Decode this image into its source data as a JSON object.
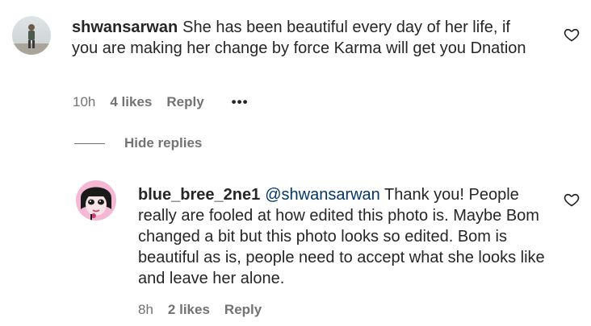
{
  "comments": [
    {
      "username": "shwansarwan",
      "mention": "",
      "text": "She has been beautiful every day of her life, if you are making her change by force Karma will get you Dnation",
      "time": "10h",
      "likes": "4 likes",
      "reply": "Reply",
      "more": "•••"
    }
  ],
  "hide_replies": {
    "label": "Hide replies"
  },
  "replies": [
    {
      "username": "blue_bree_2ne1",
      "mention": "@shwansarwan",
      "text": "Thank you! People really are fooled at how edited this photo is. Maybe Bom changed a bit but this photo looks so edited. Bom is beautiful as is, people need to accept what she looks like and leave her alone.",
      "time": "8h",
      "likes": "2 likes",
      "reply": "Reply"
    }
  ],
  "icons": {
    "like": "heart-outline-icon",
    "more": "more-options-icon"
  },
  "colors": {
    "text": "#262626",
    "secondary": "#737373",
    "mention": "#00376b"
  }
}
